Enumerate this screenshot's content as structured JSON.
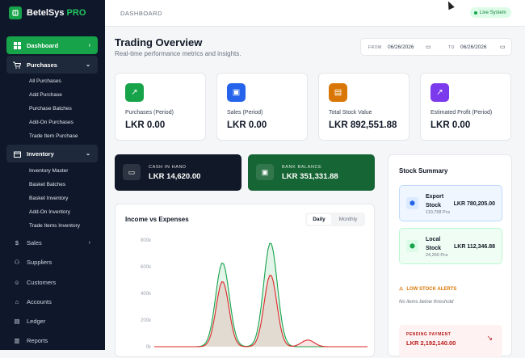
{
  "brand": {
    "name": "BetelSys",
    "pro": "PRO"
  },
  "sidebar": {
    "dashboard": "Dashboard",
    "purchases": "Purchases",
    "purchase_items": [
      "All Purchases",
      "Add Purchase",
      "Purchase Batches",
      "Add-On Purchases",
      "Trade Item Purchase"
    ],
    "inventory": "Inventory",
    "inventory_items": [
      "Inventory Master",
      "Basket Batches",
      "Basket Inventory",
      "Add-On Inventory",
      "Trade Items Inventory"
    ],
    "sales": "Sales",
    "suppliers": "Suppliers",
    "customers": "Customers",
    "accounts": "Accounts",
    "ledger": "Ledger",
    "reports": "Reports"
  },
  "topbar": {
    "breadcrumb": "DASHBOARD",
    "status": "Live System"
  },
  "header": {
    "title": "Trading Overview",
    "subtitle": "Real-time performance metrics and insights.",
    "from_label": "FROM",
    "from_date": "06/26/2026",
    "to_label": "TO",
    "to_date": "06/26/2026"
  },
  "stats": [
    {
      "label": "Purchases (Period)",
      "value": "LKR 0.00",
      "color": "#16a34a"
    },
    {
      "label": "Sales (Period)",
      "value": "LKR 0.00",
      "color": "#2563eb"
    },
    {
      "label": "Total Stock Value",
      "value": "LKR 892,551.88",
      "color": "#d97706"
    },
    {
      "label": "Estimated Profit (Period)",
      "value": "LKR 0.00",
      "color": "#7c3aed"
    }
  ],
  "balances": {
    "cash_label": "CASH IN HAND",
    "cash_value": "LKR 14,620.00",
    "bank_label": "BANK BALANCE",
    "bank_value": "LKR 351,331.88"
  },
  "chart": {
    "title": "Income vs Expenses",
    "daily": "Daily",
    "monthly": "Monthly"
  },
  "stock_summary": {
    "title": "Stock Summary",
    "export_name_1": "Export",
    "export_name_2": "Stock",
    "export_pcs": "110,758 Pcs",
    "export_value": "LKR 780,205.00",
    "local_name_1": "Local",
    "local_name_2": "Stock",
    "local_pcs": "24,260 Pcs",
    "local_value": "LKR 112,346.88",
    "low_stock": "LOW STOCK ALERTS",
    "no_items": "No items below threshold",
    "pending_label": "PENDING PAYMENT",
    "pending_value": "LKR 2,192,140.00"
  },
  "chart_data": {
    "type": "area",
    "title": "Income vs Expenses",
    "yticks": [
      "800k",
      "600k",
      "400k",
      "200k",
      "0k"
    ],
    "ylim": [
      0,
      800000
    ],
    "series": [
      {
        "color": "#16a34a",
        "values": [
          0,
          0,
          0,
          0,
          0,
          0,
          0,
          0,
          0,
          0,
          0,
          0,
          0,
          0,
          0,
          0,
          0,
          0,
          0,
          0,
          0,
          0,
          0,
          0,
          0,
          0,
          0,
          0,
          0,
          0,
          0,
          0,
          0,
          0,
          0,
          0,
          0,
          0,
          0,
          0,
          0,
          0,
          0,
          0,
          0,
          0,
          0,
          0,
          0,
          0,
          0,
          0,
          0,
          0,
          0,
          0,
          0,
          0,
          0,
          0
        ]
      },
      {
        "color": "#dc2626",
        "values": [
          0,
          0,
          0,
          0,
          0,
          0,
          0,
          0,
          0,
          0,
          0,
          0,
          0,
          0,
          0,
          0,
          0,
          0,
          0,
          0,
          0,
          0,
          0,
          0,
          0,
          0,
          0,
          0,
          0,
          0,
          0,
          0,
          0,
          0,
          0,
          0,
          0,
          0,
          0,
          0,
          0,
          0,
          0,
          0,
          0,
          0,
          0,
          0,
          0,
          0,
          0,
          0,
          0,
          0,
          0,
          0,
          0,
          0,
          0,
          0
        ]
      }
    ],
    "peaks": [
      {
        "at": 0.32,
        "income": 630000,
        "expense": 490000
      },
      {
        "at": 0.545,
        "income": 780000,
        "expense": 540000
      },
      {
        "at": 0.72,
        "income": 0,
        "expense": 50000
      }
    ]
  }
}
